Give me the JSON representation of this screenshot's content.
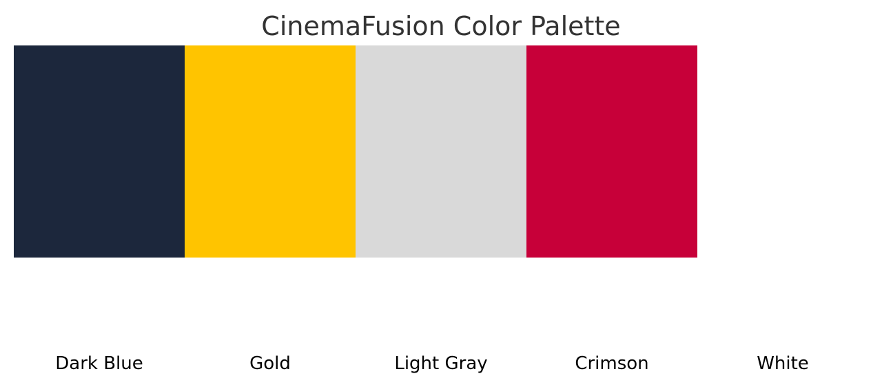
{
  "palette": {
    "title": "CinemaFusion Color Palette",
    "colors": [
      {
        "name": "Dark Blue",
        "hex": "#1c273c"
      },
      {
        "name": "Gold",
        "hex": "#ffc400"
      },
      {
        "name": "Light Gray",
        "hex": "#d9d9d9"
      },
      {
        "name": "Crimson",
        "hex": "#c70039"
      },
      {
        "name": "White",
        "hex": "#ffffff"
      }
    ]
  }
}
